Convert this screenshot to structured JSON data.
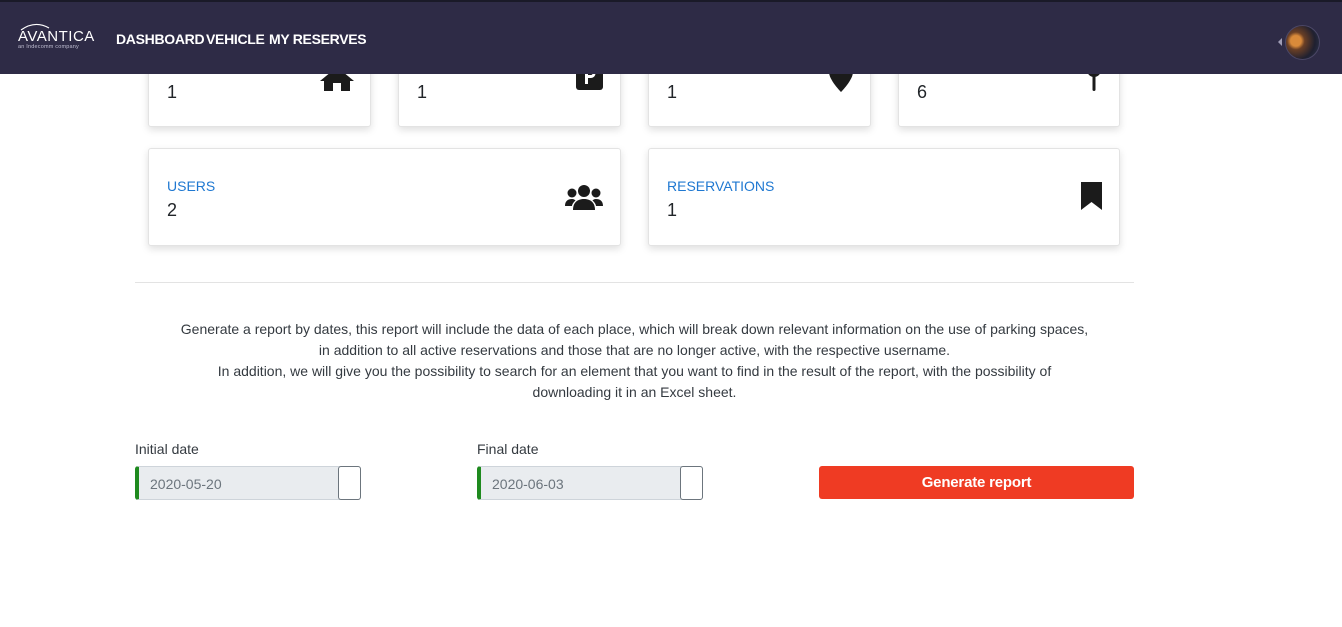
{
  "nav": {
    "logo": {
      "brand": "AVANTICA",
      "tagline": "an Indecomm company"
    },
    "links": [
      "DASHBOARD",
      "VEHICLE",
      "MY RESERVES"
    ]
  },
  "stats_top": [
    {
      "value": "1",
      "icon": "home-icon"
    },
    {
      "value": "1",
      "icon": "parking-icon"
    },
    {
      "value": "1",
      "icon": "map-marker-icon"
    },
    {
      "value": "6",
      "icon": "map-pin-icon"
    }
  ],
  "stats_bottom": [
    {
      "label": "USERS",
      "value": "2",
      "icon": "users-icon"
    },
    {
      "label": "RESERVATIONS",
      "value": "1",
      "icon": "bookmark-icon"
    }
  ],
  "report": {
    "description_lines": [
      "Generate a report by dates, this report will include the data of each place, which will break down relevant information on the use of parking spaces,",
      "in addition to all active reservations and those that are no longer active, with the respective username.",
      "In addition, we will give you the possibility to search for an element that you want to find in the result of the report, with the possibility of",
      "downloading it in an Excel sheet."
    ],
    "initial_date_label": "Initial date",
    "initial_date_value": "2020-05-20",
    "final_date_label": "Final date",
    "final_date_value": "2020-06-03",
    "generate_label": "Generate report"
  },
  "colors": {
    "navbar": "#2e2b46",
    "accent_blue": "#1f78d1",
    "button_red": "#ef3b23",
    "input_valid_border": "#1e8a1e"
  }
}
